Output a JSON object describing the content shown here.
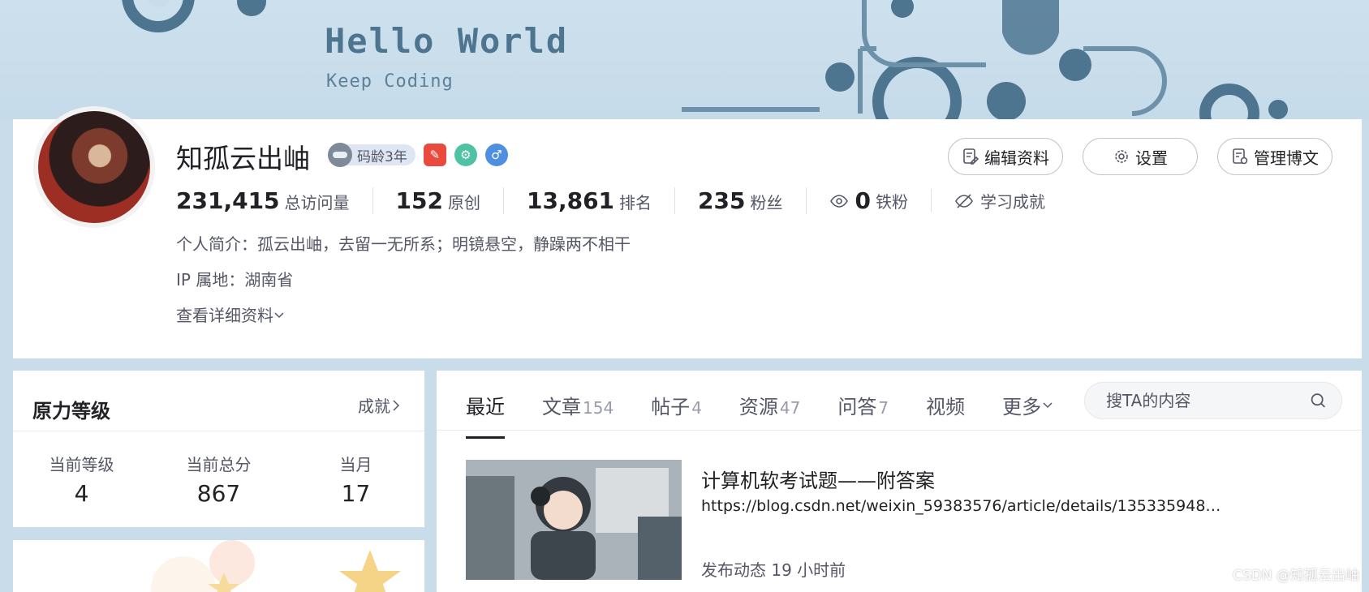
{
  "banner": {
    "title": "Hello World",
    "subtitle": "Keep Coding"
  },
  "profile": {
    "name": "知孤云出岫",
    "age_badge": "码龄3年",
    "actions": {
      "edit": "编辑资料",
      "settings": "设置",
      "manage": "管理博文"
    },
    "stats": [
      {
        "value": "231,415",
        "label": "总访问量"
      },
      {
        "value": "152",
        "label": "原创"
      },
      {
        "value": "13,861",
        "label": "排名"
      },
      {
        "value": "235",
        "label": "粉丝"
      }
    ],
    "iron_fans": {
      "value": "0",
      "label": "铁粉"
    },
    "achievement": "学习成就",
    "bio": "个人简介：孤云出岫，去留一无所系；明镜悬空，静躁两不相干",
    "ip": "IP 属地：湖南省",
    "detail_link": "查看详细资料"
  },
  "level_card": {
    "title": "原力等级",
    "link": "成就",
    "columns": [
      {
        "label": "当前等级",
        "value": "4"
      },
      {
        "label": "当前总分",
        "value": "867"
      },
      {
        "label": "当月",
        "value": "17"
      }
    ]
  },
  "tabs": [
    {
      "label": "最近",
      "count": ""
    },
    {
      "label": "文章",
      "count": "154"
    },
    {
      "label": "帖子",
      "count": "4"
    },
    {
      "label": "资源",
      "count": "47"
    },
    {
      "label": "问答",
      "count": "7"
    },
    {
      "label": "视频",
      "count": ""
    }
  ],
  "more_tab": "更多",
  "search": {
    "placeholder": "搜TA的内容"
  },
  "post": {
    "title": "计算机软考试题——附答案",
    "url": "https://blog.csdn.net/weixin_59383576/article/details/135335948?spm=1001.2014.3001.5501",
    "meta": "发布动态 19 小时前"
  },
  "watermark": "CSDN @知孤云出岫",
  "colors": {
    "banner_bg": "#c9dcea",
    "gear": "#4e7590",
    "text_primary": "#222226",
    "text_secondary": "#555666"
  }
}
